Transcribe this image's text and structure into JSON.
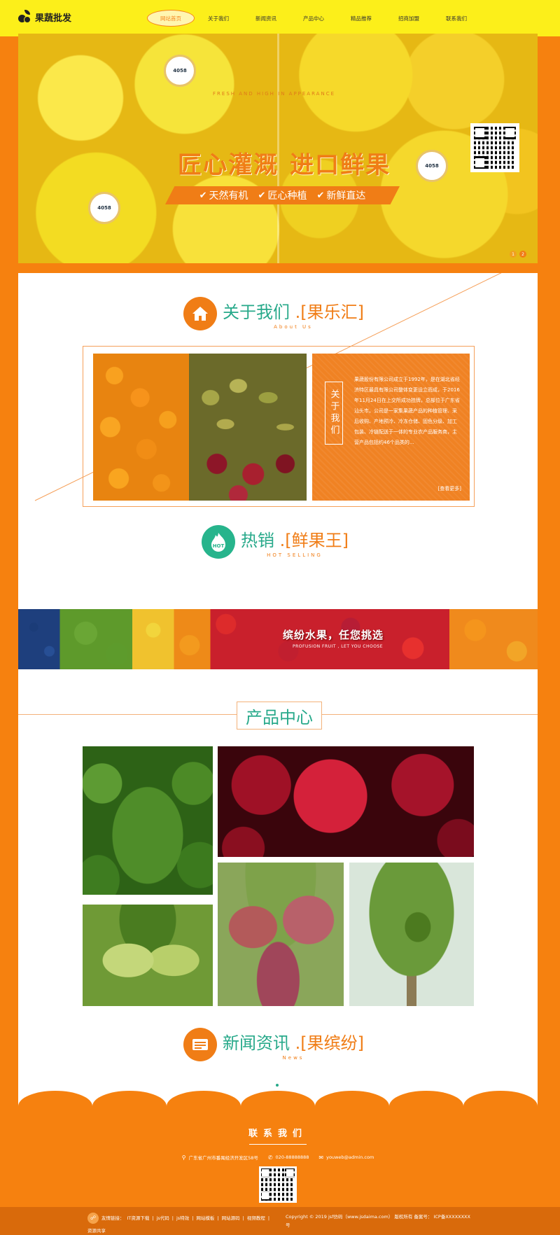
{
  "header": {
    "logo_text": "果蔬批发",
    "nav": [
      "网站首页",
      "关于我们",
      "新闻资讯",
      "产品中心",
      "精品推荐",
      "招商加盟",
      "联系我们"
    ]
  },
  "hero": {
    "title_left": "匠心灌溉",
    "title_right": "进口鲜果",
    "subtitle": "FRESH AND HIGH IN APPEARANCE",
    "features": [
      "天然有机",
      "匠心种植",
      "新鲜直达"
    ],
    "slides": [
      "1",
      "2"
    ],
    "sticker_text": "4058"
  },
  "about": {
    "title": "关于我们",
    "title_highlight": ".[果乐汇]",
    "title_en": "About Us",
    "vertical_label": "关于我们",
    "text": "果蔬股份有限公司成立于1992年，是在湖北省经济特区最具有限公司整体变更设立而成，于2016年11月24日在上交所成功挂牌，总部位于广东省汕头市。公司是一家集果蔬产品的种植管理、采后收购、产地预冷、冷冻仓储、固色分级、加工包装、冷链配送于一体的专业农产品服务商，主营产品包括约46个品类的...",
    "more": "[查看更多]"
  },
  "hot": {
    "title": "热销",
    "title_highlight": ".[鲜果王]",
    "title_en": "HOT SELLING",
    "icon_label": "HOT"
  },
  "banner": {
    "text": "缤纷水果，任您挑选",
    "sub": "PROFUSION FRUIT , LET YOU CHOOSE"
  },
  "products": {
    "title": "产品中心"
  },
  "news": {
    "title": "新闻资讯",
    "title_highlight": ".[果缤纷]",
    "title_en": "News"
  },
  "footer": {
    "contact_title": "联系我们",
    "address": "广东省广州市番禺经济开发区58号",
    "phone": "020-88888888",
    "email": "youweb@admin.com",
    "friend_links_label": "友情链接：",
    "friend_links": [
      "IT资源下载",
      "js代码",
      "js特效",
      "网站模板",
      "网站源码",
      "视频教程",
      "资源共享"
    ],
    "copyright": "Copyright © 2019 jsf仿码（www.jsdaima.com） 版权所有 备案号： ICP备XXXXXXXX号"
  },
  "colors": {
    "orange": "#f6810f",
    "yellow": "#fcef1a",
    "green": "#27a98a"
  }
}
